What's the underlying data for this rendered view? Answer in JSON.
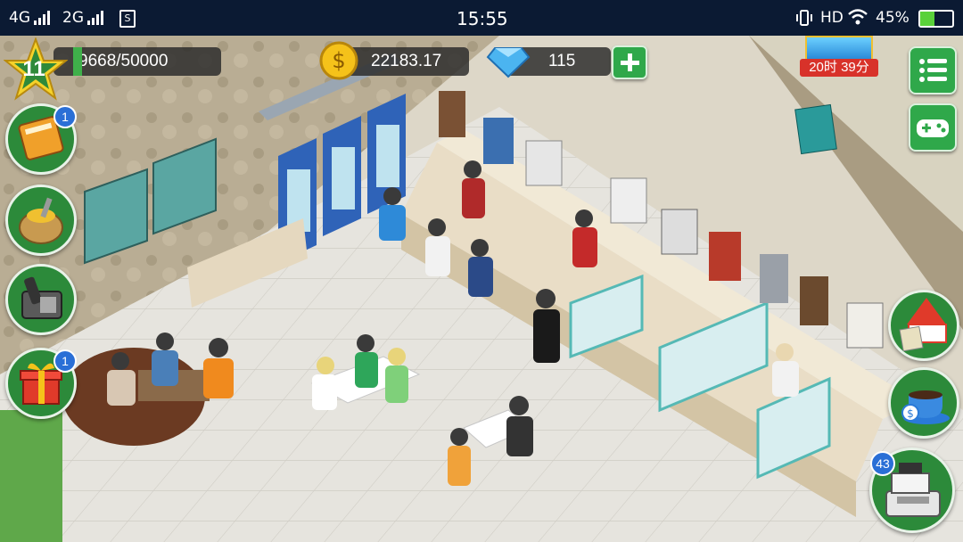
{
  "status_bar": {
    "network_left": "4G",
    "network_right": "2G",
    "time": "15:55",
    "hd": "HD",
    "battery": "45%"
  },
  "hud": {
    "level": "11",
    "xp": "9668/50000",
    "coins": "22183.17",
    "gems": "115",
    "event_timer": "20时 39分"
  },
  "badges": {
    "recipes": "1",
    "gifts": "1",
    "register": "43"
  },
  "colors": {
    "status_bar_bg": "#0b1a33",
    "button_green": "#2c8a3a",
    "badge_blue": "#2a6fd6",
    "timer_red": "#d8322a"
  }
}
